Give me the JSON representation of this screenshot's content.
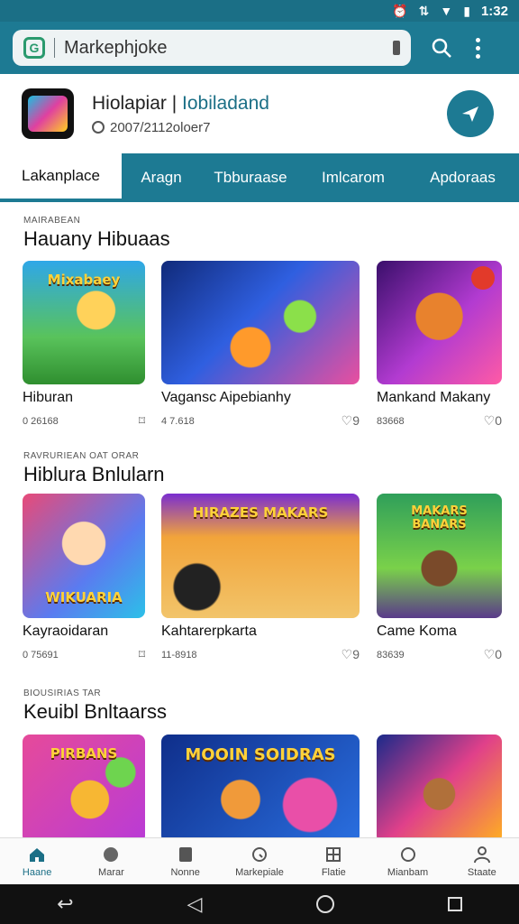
{
  "status_bar": {
    "time": "1:32",
    "icons": [
      "alarm-icon",
      "data-icon",
      "wifi-icon",
      "battery-icon"
    ]
  },
  "search": {
    "value": "Markephjoke",
    "logo": "G"
  },
  "profile": {
    "title_main": "Hiolapiar |",
    "title_accent": "Iobiladand",
    "subtitle": "2007/2112oloer7"
  },
  "tabs": [
    {
      "label": "Lakanplace"
    },
    {
      "label": "Aragn"
    },
    {
      "label": "Tbburaase"
    },
    {
      "label": "Imlcarom"
    },
    {
      "label": "Apdoraas"
    }
  ],
  "sections": [
    {
      "overline": "MAIRABEAN",
      "heading": "Hauany Hibuaas",
      "cards": [
        {
          "title": "Hiburan",
          "meta": "0 26168",
          "thumb_label": "Mixabaey"
        },
        {
          "title": "Vagansc Aipebianhy",
          "meta": "4 7.618",
          "thumb_label": ""
        },
        {
          "title": "Mankand Makany",
          "meta": "83668",
          "thumb_label": ""
        }
      ],
      "likes": [
        "",
        "9",
        "0"
      ]
    },
    {
      "overline": "RAVRURIEAN OAT ORAR",
      "heading": "Hiblura Bnlularn",
      "cards": [
        {
          "title": "Kayraoidaran",
          "meta": "0 75691",
          "thumb_label": "WIKUARIA"
        },
        {
          "title": "Kahtarerpkarta",
          "meta": "11-8918",
          "thumb_label": "HIRAZES  MAKARS"
        },
        {
          "title": "Came Koma",
          "meta": "83639",
          "thumb_label": "MAKARS BANARS"
        }
      ],
      "likes": [
        "",
        "9",
        "0"
      ]
    },
    {
      "overline": "BIOUSIRIAS TAR",
      "heading": "Keuibl Bnltaarss",
      "cards": [
        {
          "title": "",
          "meta": "",
          "thumb_label": "PIRBANS"
        },
        {
          "title": "",
          "meta": "",
          "thumb_label": "MOOIN  SOIDRAS"
        },
        {
          "title": "",
          "meta": "",
          "thumb_label": ""
        }
      ],
      "likes": [
        "",
        "",
        ""
      ]
    }
  ],
  "bottom_nav": [
    {
      "label": "Haane",
      "icon": "home-icon"
    },
    {
      "label": "Marar",
      "icon": "globe-icon"
    },
    {
      "label": "Nonne",
      "icon": "card-icon"
    },
    {
      "label": "Markepiale",
      "icon": "clock-icon"
    },
    {
      "label": "Flatie",
      "icon": "grid-icon"
    },
    {
      "label": "Mianbam",
      "icon": "heart-icon"
    },
    {
      "label": "Staate",
      "icon": "person-icon"
    }
  ],
  "colors": {
    "primary": "#1d7a93",
    "status": "#1b6f86",
    "accent_text": "#1b6f86"
  }
}
